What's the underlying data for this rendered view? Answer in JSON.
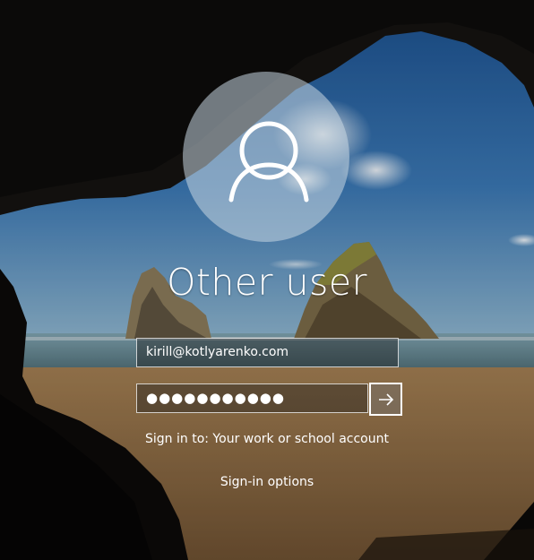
{
  "user": {
    "display_name": "Other user",
    "avatar_icon": "user-silhouette-icon"
  },
  "form": {
    "email_value": "kirill@kotlyarenko.com",
    "password_value": "●●●●●●●●●●●",
    "submit_icon": "arrow-right-icon"
  },
  "footer": {
    "signin_to": "Sign in to: Your work or school account",
    "signin_options": "Sign-in options"
  },
  "colors": {
    "text": "#ffffff",
    "sky": "#2f6aa6",
    "sand": "#b08958"
  }
}
